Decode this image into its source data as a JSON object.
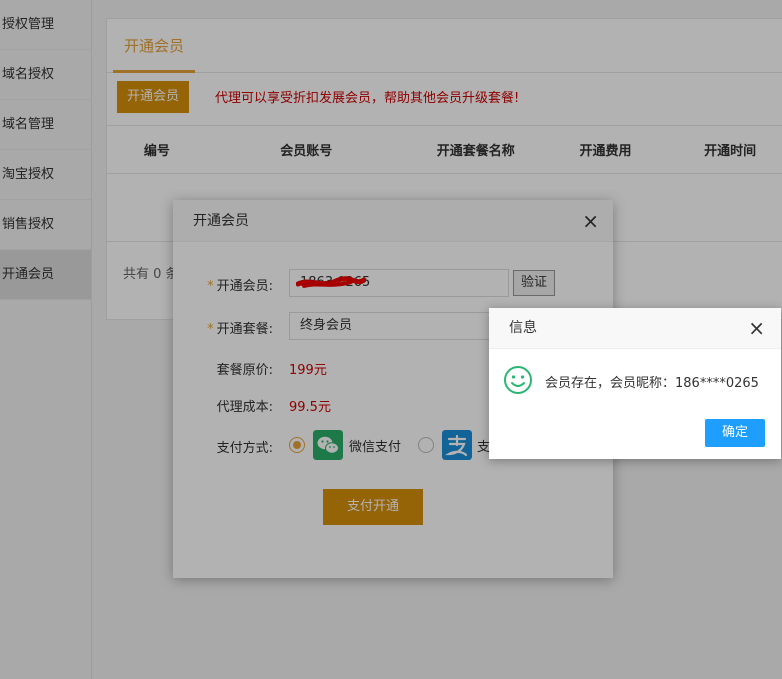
{
  "sidebar": {
    "items": [
      {
        "label": "授权管理"
      },
      {
        "label": "域名授权"
      },
      {
        "label": "域名管理"
      },
      {
        "label": "淘宝授权"
      },
      {
        "label": "销售授权"
      },
      {
        "label": "开通会员"
      }
    ]
  },
  "main": {
    "tab_label": "开通会员",
    "open_button": "开通会员",
    "notice": "代理可以享受折扣发展会员，帮助其他会员升级套餐!",
    "table_headers": [
      "编号",
      "会员账号",
      "开通套餐名称",
      "开通费用",
      "开通时间"
    ],
    "pager_text": "共有 0 条"
  },
  "dialog": {
    "title": "开通会员",
    "close_icon": "×",
    "member_label": "开通会员:",
    "member_value": "186****0265",
    "member_display": "1863   0265",
    "verify_button": "验证",
    "package_label": "开通套餐:",
    "package_value": "终身会员",
    "price_label": "套餐原价:",
    "price_value": "199元",
    "cost_label": "代理成本:",
    "cost_value": "99.5元",
    "pay_label": "支付方式:",
    "wechat_label": "微信支付",
    "alipay_label": "支",
    "pay_button": "支付开通"
  },
  "info": {
    "title": "信息",
    "close_icon": "×",
    "message": "会员存在，会员昵称：186****0265",
    "ok_button": "确定"
  },
  "colors": {
    "accent": "#d4900b",
    "tab_accent": "#e6a23c",
    "danger": "#cc0000",
    "primary": "#1e9fff"
  }
}
